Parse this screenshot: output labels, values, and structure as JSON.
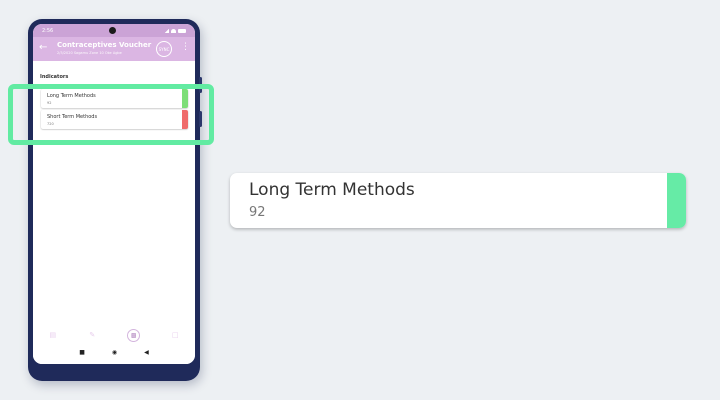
{
  "status_bar": {
    "time": "2:56"
  },
  "app_bar": {
    "title": "Contraceptives Voucher",
    "subtitle": "2/3/2020 Sagamu Zone 10 Oke Agbe",
    "sync_label": "SYNC"
  },
  "indicators": {
    "heading": "Indicators",
    "items": [
      {
        "label": "Long Term Methods",
        "value": "92",
        "color": "#7dde78"
      },
      {
        "label": "Short Term Methods",
        "value": "720",
        "color": "#ef6b6b"
      }
    ]
  },
  "zoomed_card": {
    "label": "Long Term Methods",
    "value": "92",
    "color": "#66eba6"
  },
  "highlight_color": "#62eba2",
  "bottom_nav": {
    "icons": [
      "form-icon",
      "edit-icon",
      "chart-icon",
      "message-icon"
    ],
    "active": "chart-icon"
  },
  "system_nav": {
    "icons": [
      "square-icon",
      "home-icon",
      "back-triangle-icon"
    ]
  }
}
